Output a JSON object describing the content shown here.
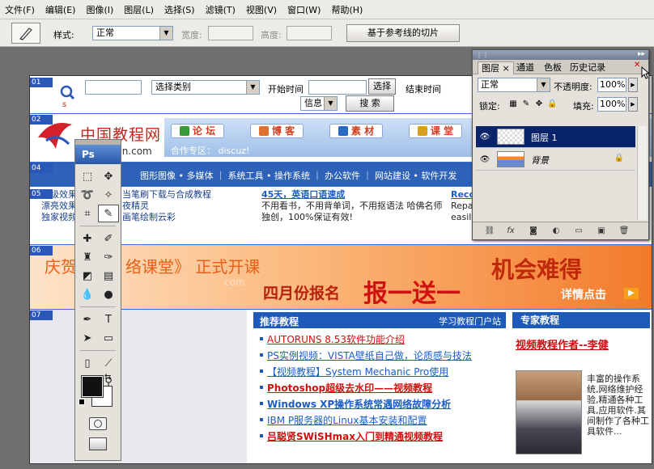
{
  "menubar": {
    "items": [
      "文件(F)",
      "编辑(E)",
      "图像(I)",
      "图层(L)",
      "选择(S)",
      "滤镜(T)",
      "视图(V)",
      "窗口(W)",
      "帮助(H)"
    ]
  },
  "options": {
    "style_label": "样式:",
    "style_value": "正常",
    "width_label": "宽度:",
    "height_label": "高度:",
    "slice_button": "基于参考线的切片"
  },
  "canvas": {
    "slice_tags": [
      "01",
      "02",
      "04",
      "05",
      "06",
      "07"
    ],
    "search": {
      "category_select": "选择类别",
      "start_time_label": "开始时间",
      "select_button": "选择",
      "end_time_label": "结束时间",
      "info_select": "信息",
      "search_button": "搜 索"
    },
    "header": {
      "logo_text": "中国教程网",
      "logo_url": "vcn.com",
      "nav": [
        "论 坛",
        "博 客",
        "素 材",
        "课 堂"
      ],
      "cooperation": "合作专区： discuz!"
    },
    "categories": "图形图像 • 多媒体 ｜ 系统工具 • 操作系统 ｜ 办公软件 ｜ 网站建设 • 软件开发",
    "news": {
      "left": [
        "超级效果",
        "漂亮效果",
        "独家视频"
      ],
      "mid": [
        "当笔刷下载与合成教程",
        "夜精灵",
        "画笔绘制云彩"
      ],
      "promo_title": "45天，英语口语速成",
      "promo_lines": [
        "不用看书，不用背单词，不用抠语法 哈佛名师",
        "独创，100%保证有效!"
      ],
      "right_title": "Reco",
      "right_lines": [
        "Repai",
        "easily"
      ]
    },
    "banner": {
      "left_text": "庆贺",
      "main_text": "络课堂》 正式开课",
      "april_text": "四月份报名",
      "big_text": "报一送一",
      "right_text": "机会难得",
      "detail_text": "详情点击",
      "watermark": "com"
    },
    "recommend": {
      "title": "推荐教程",
      "portal": "学习教程门户站",
      "items": [
        {
          "text": "AUTORUNS 8.53软件功能介绍",
          "color": "#d01010",
          "bold": false
        },
        {
          "text": "PS实例视频：VISTA壁纸自己做，论质感与技法",
          "color": "#1a5cc8",
          "bold": false
        },
        {
          "text": "【视频教程】System Mechanic Pro使用",
          "color": "#1a5cc8",
          "bold": false
        },
        {
          "text": "Photoshop超级去水印——视频教程",
          "color": "#d01010",
          "bold": true
        },
        {
          "text": "Windows XP操作系统常遇网络故障分析",
          "color": "#1a5cc8",
          "bold": true
        },
        {
          "text": "IBM P服务器的Linux基本安装和配置",
          "color": "#1a5cc8",
          "bold": false
        },
        {
          "text": "吕聪贤SWiSHmax入门到精通视频教程",
          "color": "#d01010",
          "bold": true
        }
      ]
    },
    "expert": {
      "title": "专家教程",
      "author_link": "视频教程作者--李健",
      "bio": "丰富的操作系统,网络维护经验,精通各种工具,应用软件.其间制作了各种工具软件..."
    }
  },
  "toolbox": {
    "logo": "Ps"
  },
  "layers_panel": {
    "tabs": [
      "图层",
      "通道",
      "色板",
      "历史记录"
    ],
    "blend_mode": "正常",
    "opacity_label": "不透明度:",
    "opacity_value": "100%",
    "lock_label": "锁定:",
    "fill_label": "填充:",
    "fill_value": "100%",
    "layers": [
      {
        "name": "图层 1",
        "selected": true
      },
      {
        "name": "背景",
        "selected": false
      }
    ]
  }
}
